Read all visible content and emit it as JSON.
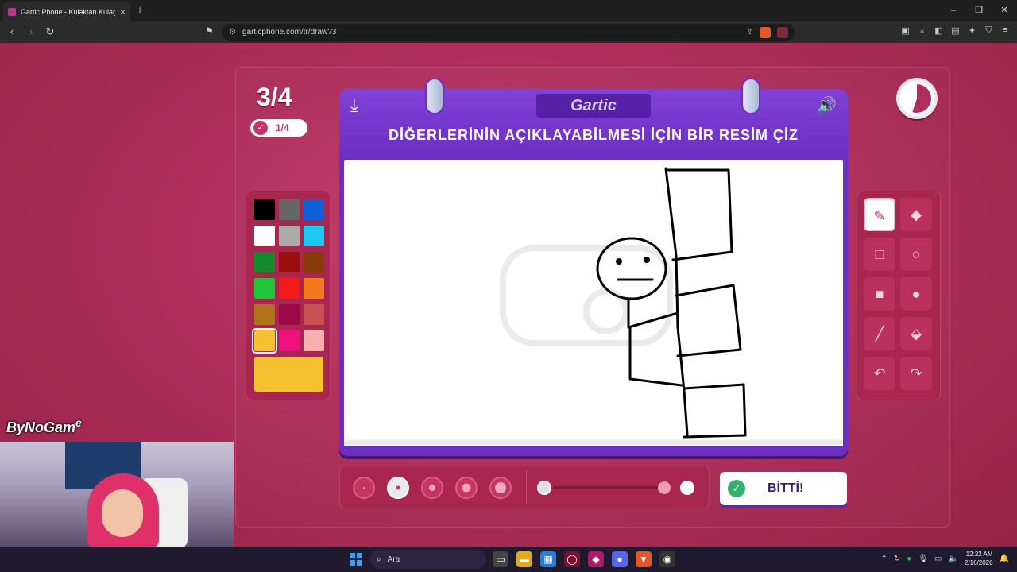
{
  "browser": {
    "tab_title": "Gartic Phone - Kulaktan Kulağa",
    "tab_close": "×",
    "new_tab": "+",
    "url": "garticphone.com/tr/draw?3",
    "window_controls": [
      "–",
      "❐",
      "✕"
    ]
  },
  "game": {
    "round": "3/4",
    "counter": "1/4",
    "logo": "Gartic",
    "prompt": "DİĞERLERİNİN AÇIKLAYABİLMESİ İÇİN BİR RESİM ÇİZ",
    "done_label": "BİTTİ!",
    "colors": [
      "#000000",
      "#666666",
      "#1060d8",
      "#ffffff",
      "#aaaaaa",
      "#1ec8f4",
      "#138a2a",
      "#9a0e0e",
      "#8a3c0c",
      "#1fc63a",
      "#f21a1a",
      "#f27a1c",
      "#b07418",
      "#9a0846",
      "#c85050",
      "#f6c130",
      "#f0117f",
      "#f7b0ae"
    ],
    "selected_color": "#f6c130",
    "tools": [
      "pencil-icon",
      "eraser-icon",
      "square-outline-icon",
      "circle-outline-icon",
      "square-filled-icon",
      "circle-filled-icon",
      "line-icon",
      "fill-bucket-icon",
      "undo-icon",
      "redo-icon"
    ],
    "brush_sizes": 5,
    "selected_brush": 2
  },
  "overlay": {
    "brand": "ByNoGam",
    "brand_sup": "e"
  },
  "taskbar": {
    "search": "Ara",
    "time": "12:22 AM",
    "date": "2/16/2026"
  }
}
